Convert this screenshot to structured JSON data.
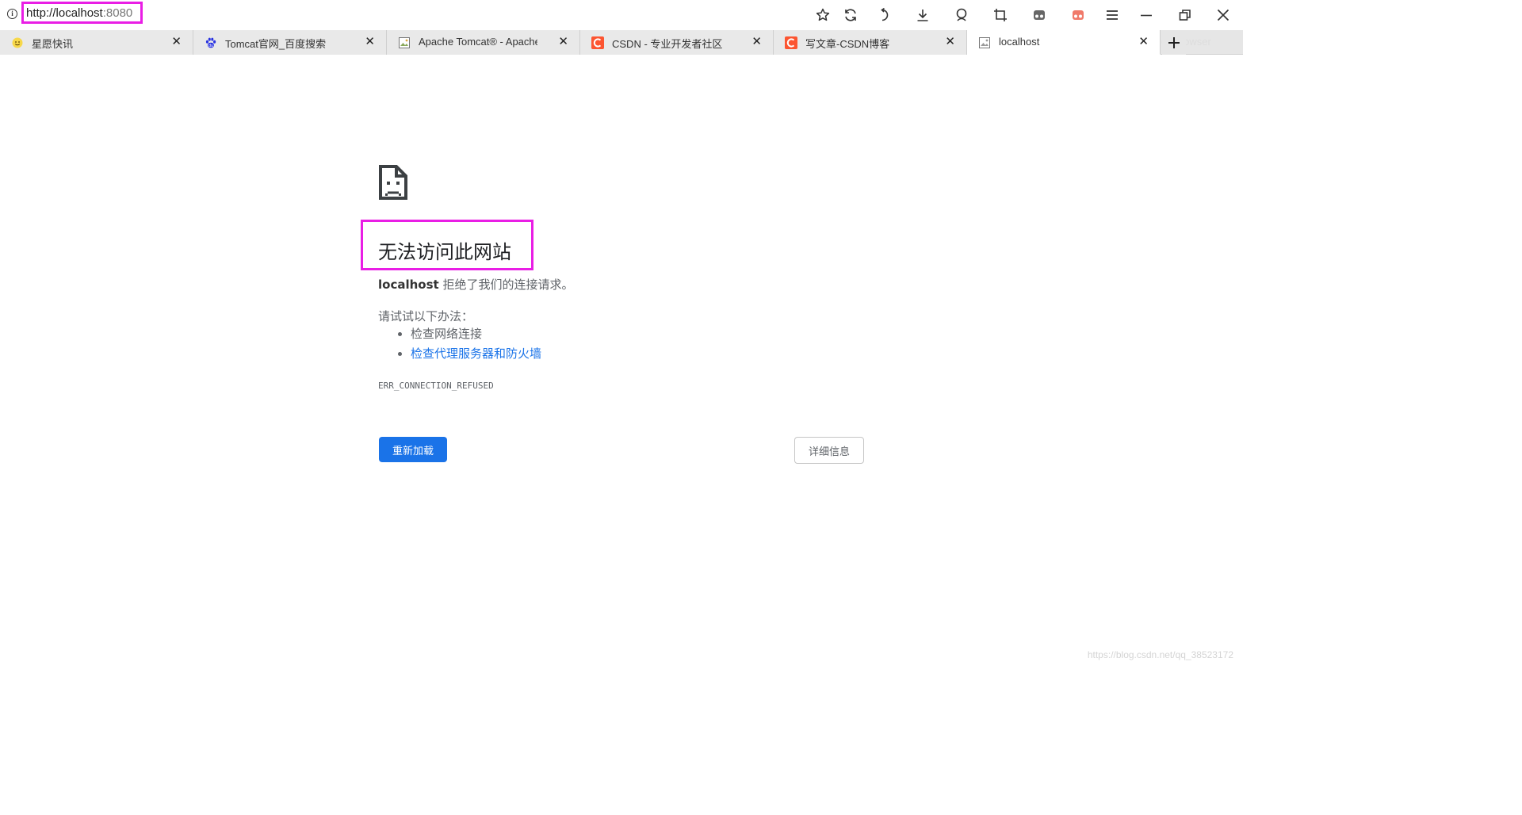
{
  "address_bar": {
    "url_host": "http://localhost",
    "url_port": ":8080"
  },
  "tabs": [
    {
      "label": "星愿快讯",
      "favicon": "smiley-favicon",
      "color": "#f3c623",
      "active": false
    },
    {
      "label": "Tomcat官网_百度搜索",
      "favicon": "baidu-paw-favicon",
      "color": "#2932e1",
      "active": false
    },
    {
      "label": "Apache Tomcat® - Apache T",
      "favicon": "broken-image-favicon",
      "color": "#8a8a8a",
      "active": false
    },
    {
      "label": "CSDN - 专业开发者社区",
      "favicon": "csdn-c-favicon",
      "color": "#fc5531",
      "active": false
    },
    {
      "label": "写文章-CSDN博客",
      "favicon": "csdn-c-favicon",
      "color": "#fc5531",
      "active": false
    },
    {
      "label": "localhost",
      "favicon": "broken-image-favicon",
      "color": "#8a8a8a",
      "active": true
    }
  ],
  "tab_close_glyph": "✕",
  "ghost_tab_text": "er Browser",
  "error_page": {
    "title": "无法访问此网站",
    "host": "localhost",
    "message": "拒绝了我们的连接请求。",
    "try_heading": "请试试以下办法：",
    "suggestions": [
      "检查网络连接",
      "检查代理服务器和防火墙"
    ],
    "error_code": "ERR_CONNECTION_REFUSED",
    "reload_button": "重新加载",
    "details_button": "详细信息"
  },
  "watermark": "https://blog.csdn.net/qq_38523172",
  "colors": {
    "highlight": "#e91ee5",
    "primary_button": "#1a73e8",
    "link": "#1a73e8"
  }
}
